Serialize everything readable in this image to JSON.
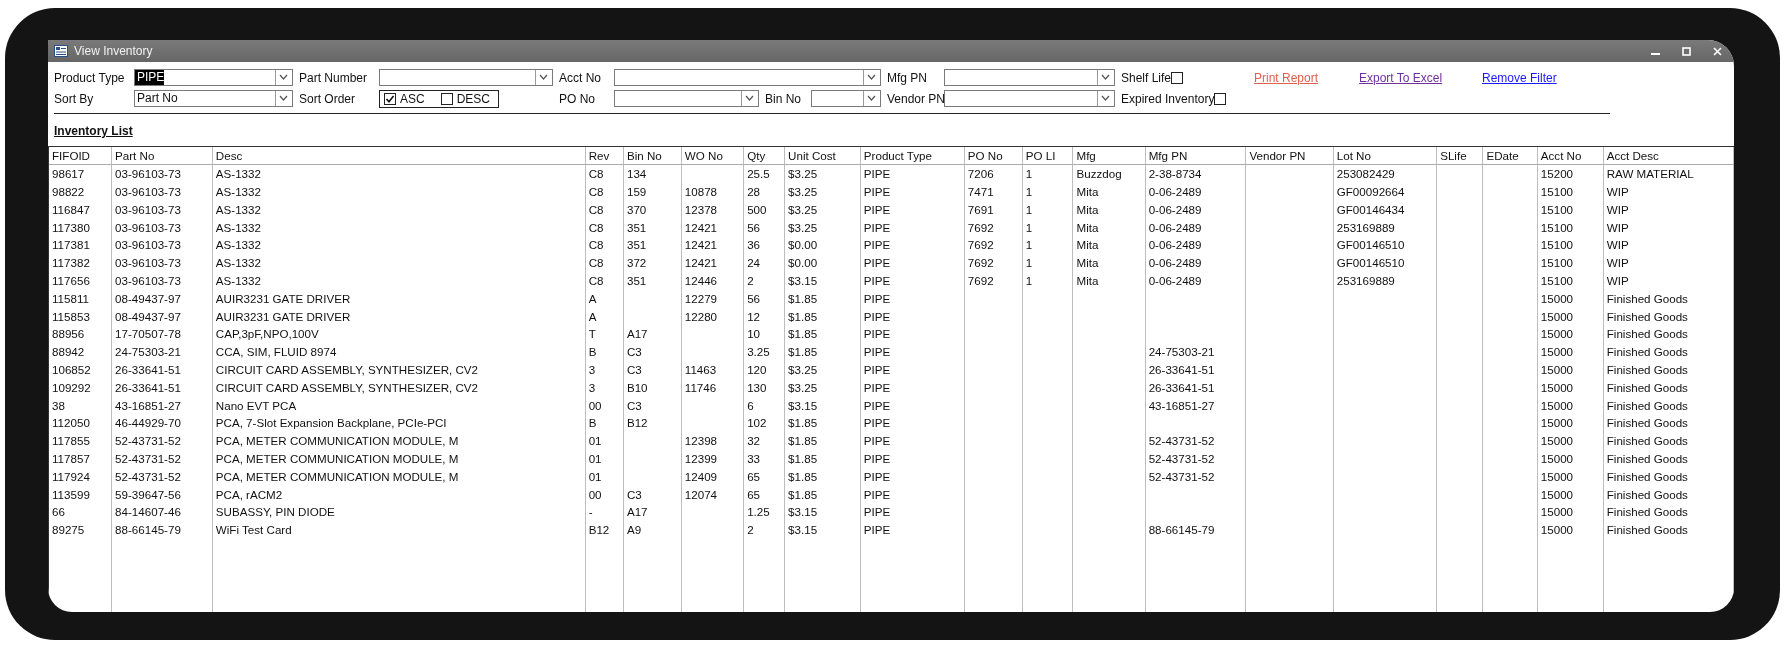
{
  "window": {
    "title": "View Inventory"
  },
  "filter_rows": [
    [
      {
        "kind": "combo",
        "label": "Product Type",
        "value": "PIPE",
        "highlighted": true
      },
      {
        "kind": "combo",
        "label": "Part Number"
      },
      {
        "kind": "combo",
        "label": "Acct No"
      },
      {
        "kind": "combo",
        "label": "Mfg PN"
      },
      {
        "kind": "check",
        "label": "Shelf Life",
        "checked": false
      },
      {
        "kind": "link",
        "label": "Print Report",
        "color": "#e0604f"
      },
      {
        "kind": "link",
        "label": "Export To Excel",
        "color": "#7030a0"
      },
      {
        "kind": "link",
        "label": "Remove Filter",
        "color": "#1a1aff"
      }
    ],
    [
      {
        "kind": "combo",
        "label": "Sort By",
        "value": "Part No",
        "highlighted": false
      },
      {
        "kind": "sort_order",
        "label": "Sort Order",
        "options": [
          {
            "label": "ASC",
            "checked": true
          },
          {
            "label": "DESC",
            "checked": false
          }
        ]
      },
      {
        "kind": "combo",
        "label": "PO No"
      },
      {
        "kind": "combo",
        "label": "Bin No"
      },
      {
        "kind": "combo",
        "label": "Vendor PN"
      },
      {
        "kind": "check",
        "label": "Expired Inventory",
        "checked": false
      }
    ]
  ],
  "list_title": "Inventory List",
  "table": {
    "columns": [
      "FIFOID",
      "Part No",
      "Desc",
      "Rev",
      "Bin No",
      "WO No",
      "Qty",
      "Unit Cost",
      "Product Type",
      "PO No",
      "PO LI",
      "Mfg",
      "Mfg PN",
      "Vendor PN",
      "Lot No",
      "SLife",
      "EDate",
      "Acct No",
      "Acct Desc"
    ],
    "rows": [
      [
        "98617",
        "03-96103-73",
        "AS-1332",
        "C8",
        "134",
        null,
        "25.5",
        "$3.25",
        "PIPE",
        "7206",
        "1",
        "Buzzdog",
        "2-38-8734",
        null,
        "253082429",
        null,
        null,
        "15200",
        "RAW MATERIAL"
      ],
      [
        "98822",
        "03-96103-73",
        "AS-1332",
        "C8",
        "159",
        "10878",
        "28",
        "$3.25",
        "PIPE",
        "7471",
        "1",
        "Mita",
        "0-06-2489",
        null,
        "GF00092664",
        null,
        null,
        "15100",
        "WIP"
      ],
      [
        "116847",
        "03-96103-73",
        "AS-1332",
        "C8",
        "370",
        "12378",
        "500",
        "$3.25",
        "PIPE",
        "7691",
        "1",
        "Mita",
        "0-06-2489",
        null,
        "GF00146434",
        null,
        null,
        "15100",
        "WIP"
      ],
      [
        "117380",
        "03-96103-73",
        "AS-1332",
        "C8",
        "351",
        "12421",
        "56",
        "$3.25",
        "PIPE",
        "7692",
        "1",
        "Mita",
        "0-06-2489",
        null,
        "253169889",
        null,
        null,
        "15100",
        "WIP"
      ],
      [
        "117381",
        "03-96103-73",
        "AS-1332",
        "C8",
        "351",
        "12421",
        "36",
        "$0.00",
        "PIPE",
        "7692",
        "1",
        "Mita",
        "0-06-2489",
        null,
        "GF00146510",
        null,
        null,
        "15100",
        "WIP"
      ],
      [
        "117382",
        "03-96103-73",
        "AS-1332",
        "C8",
        "372",
        "12421",
        "24",
        "$0.00",
        "PIPE",
        "7692",
        "1",
        "Mita",
        "0-06-2489",
        null,
        "GF00146510",
        null,
        null,
        "15100",
        "WIP"
      ],
      [
        "117656",
        "03-96103-73",
        "AS-1332",
        "C8",
        "351",
        "12446",
        "2",
        "$3.15",
        "PIPE",
        "7692",
        "1",
        "Mita",
        "0-06-2489",
        null,
        "253169889",
        null,
        null,
        "15100",
        "WIP"
      ],
      [
        "115811",
        "08-49437-97",
        "AUIR3231 GATE DRIVER",
        "A",
        null,
        "12279",
        "56",
        "$1.85",
        "PIPE",
        null,
        null,
        null,
        null,
        null,
        null,
        null,
        null,
        "15000",
        "Finished Goods"
      ],
      [
        "115853",
        "08-49437-97",
        "AUIR3231 GATE DRIVER",
        "A",
        null,
        "12280",
        "12",
        "$1.85",
        "PIPE",
        null,
        null,
        null,
        null,
        null,
        null,
        null,
        null,
        "15000",
        "Finished Goods"
      ],
      [
        "88956",
        "17-70507-78",
        "CAP,3pF,NPO,100V",
        "T",
        "A17",
        null,
        "10",
        "$1.85",
        "PIPE",
        null,
        null,
        null,
        null,
        null,
        null,
        null,
        null,
        "15000",
        "Finished Goods"
      ],
      [
        "88942",
        "24-75303-21",
        "CCA, SIM, FLUID 8974",
        "B",
        "C3",
        null,
        "3.25",
        "$1.85",
        "PIPE",
        null,
        null,
        null,
        "24-75303-21",
        null,
        null,
        null,
        null,
        "15000",
        "Finished Goods"
      ],
      [
        "106852",
        "26-33641-51",
        "CIRCUIT CARD ASSEMBLY, SYNTHESIZER, CV2",
        "3",
        "C3",
        "11463",
        "120",
        "$3.25",
        "PIPE",
        null,
        null,
        null,
        "26-33641-51",
        null,
        null,
        null,
        null,
        "15000",
        "Finished Goods"
      ],
      [
        "109292",
        "26-33641-51",
        "CIRCUIT CARD ASSEMBLY, SYNTHESIZER, CV2",
        "3",
        "B10",
        "11746",
        "130",
        "$3.25",
        "PIPE",
        null,
        null,
        null,
        "26-33641-51",
        null,
        null,
        null,
        null,
        "15000",
        "Finished Goods"
      ],
      [
        "38",
        "43-16851-27",
        "Nano EVT PCA",
        "00",
        "C3",
        null,
        "6",
        "$3.15",
        "PIPE",
        null,
        null,
        null,
        "43-16851-27",
        null,
        null,
        null,
        null,
        "15000",
        "Finished Goods"
      ],
      [
        "112050",
        "46-44929-70",
        "PCA, 7-Slot Expansion Backplane, PCIe-PCI",
        "B",
        "B12",
        null,
        "102",
        "$1.85",
        "PIPE",
        null,
        null,
        null,
        null,
        null,
        null,
        null,
        null,
        "15000",
        "Finished Goods"
      ],
      [
        "117855",
        "52-43731-52",
        "PCA, METER COMMUNICATION MODULE, M",
        "01",
        null,
        "12398",
        "32",
        "$1.85",
        "PIPE",
        null,
        null,
        null,
        "52-43731-52",
        null,
        null,
        null,
        null,
        "15000",
        "Finished Goods"
      ],
      [
        "117857",
        "52-43731-52",
        "PCA, METER COMMUNICATION MODULE, M",
        "01",
        null,
        "12399",
        "33",
        "$1.85",
        "PIPE",
        null,
        null,
        null,
        "52-43731-52",
        null,
        null,
        null,
        null,
        "15000",
        "Finished Goods"
      ],
      [
        "117924",
        "52-43731-52",
        "PCA, METER COMMUNICATION MODULE, M",
        "01",
        null,
        "12409",
        "65",
        "$1.85",
        "PIPE",
        null,
        null,
        null,
        "52-43731-52",
        null,
        null,
        null,
        null,
        "15000",
        "Finished Goods"
      ],
      [
        "113599",
        "59-39647-56",
        "PCA, rACM2",
        "00",
        "C3",
        "12074",
        "65",
        "$1.85",
        "PIPE",
        null,
        null,
        null,
        null,
        null,
        null,
        null,
        null,
        "15000",
        "Finished Goods"
      ],
      [
        "66",
        "84-14607-46",
        "SUBASSY, PIN DIODE",
        "-",
        "A17",
        null,
        "1.25",
        "$3.15",
        "PIPE",
        null,
        null,
        null,
        null,
        null,
        null,
        null,
        null,
        "15000",
        "Finished Goods"
      ],
      [
        "89275",
        "88-66145-79",
        "WiFi Test Card",
        "B12",
        "A9",
        null,
        "2",
        "$3.15",
        "PIPE",
        null,
        null,
        null,
        "88-66145-79",
        null,
        null,
        null,
        null,
        "15000",
        "Finished Goods"
      ]
    ]
  }
}
